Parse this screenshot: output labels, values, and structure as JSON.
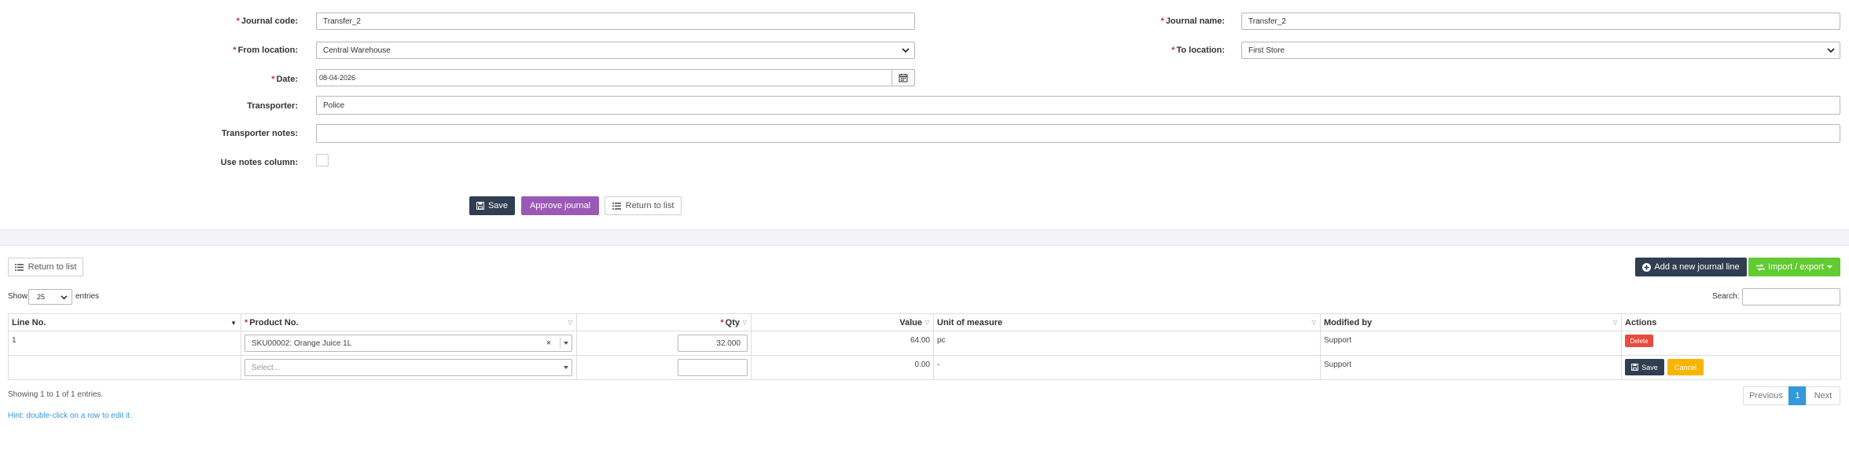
{
  "form": {
    "journal_code_label": "Journal code:",
    "journal_code_value": "Transfer_2",
    "journal_name_label": "Journal name:",
    "journal_name_value": "Transfer_2",
    "from_location_label": "From location:",
    "from_location_value": "Central Warehouse",
    "to_location_label": "To location:",
    "to_location_value": "First Store",
    "date_label": "Date:",
    "date_value": "08-04-2026",
    "transporter_label": "Transporter:",
    "transporter_value": "Police",
    "transporter_notes_label": "Transporter notes:",
    "transporter_notes_value": "",
    "use_notes_label": "Use notes column:",
    "use_notes_checked": false
  },
  "form_actions": {
    "save": "Save",
    "approve": "Approve journal",
    "return": "Return to list"
  },
  "lines_toolbar": {
    "return": "Return to list",
    "add_line": "Add a new journal line",
    "import_export": "Import / export"
  },
  "table_controls": {
    "show_label": "Show",
    "page_size": "25",
    "entries_label": "entries",
    "search_label": "Search:"
  },
  "table": {
    "columns": [
      "Line No.",
      "Product No.",
      "Qty",
      "Value",
      "Unit of measure",
      "Modified by",
      "Actions"
    ],
    "rows": [
      {
        "line_no": "1",
        "product": "SKU00002: Orange Juice 1L",
        "qty": "32.000",
        "value": "64.00",
        "unit": "pc",
        "modified_by": "Support",
        "action": "Delete"
      },
      {
        "line_no": "",
        "product_placeholder": "Select...",
        "qty": "",
        "value": "0.00",
        "unit": "-",
        "modified_by": "Support",
        "save": "Save",
        "cancel": "Cancel"
      }
    ]
  },
  "footer": {
    "showing": "Showing 1 to 1 of 1 entries.",
    "previous": "Previous",
    "page": "1",
    "next": "Next",
    "hint": "Hint: double-click on a row to edit it."
  },
  "colors": {
    "required": "#c0392b",
    "dark_button": "#2f3e50",
    "purple_button": "#9b59b6",
    "green_button": "#62cb31",
    "delete_button": "#e74c3c",
    "cancel_button": "#f7b500",
    "pager_active": "#3498db",
    "hint_text": "#3498db"
  }
}
